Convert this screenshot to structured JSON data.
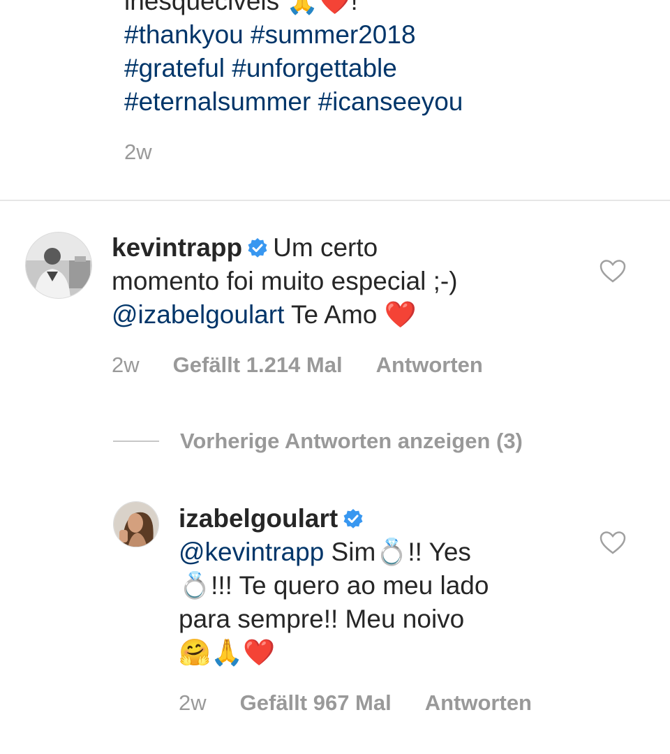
{
  "caption": {
    "line1": "inesqueciveis 🙏❤️!",
    "hashtags_line1": "#thankyou #summer2018",
    "hashtags_line2": "#grateful #unforgettable",
    "hashtags_line3": "#eternalsummer #icanseeyou",
    "time": "2w"
  },
  "comments": [
    {
      "username": "kevintrapp",
      "text_line1": "Um certo",
      "text_line2": "momento foi muito especial ;-)",
      "mention": "@izabelgoulart",
      "text_line3": " Te Amo ",
      "emoji": "❤️",
      "time": "2w",
      "likes": "Gefällt 1.214 Mal",
      "reply": "Antworten"
    }
  ],
  "replies_toggle": "Vorherige Antworten anzeigen (3)",
  "reply_comment": {
    "username": "izabelgoulart",
    "mention": "@kevintrapp",
    "text_a": " Sim",
    "ring1": "💍",
    "text_b": "!! Yes",
    "ring2": "💍",
    "text_c": "!!! Te quero ao meu lado",
    "text_d": "para sempre!! Meu noivo",
    "emojis": "🤗🙏❤️",
    "time": "2w",
    "likes": "Gefällt 967 Mal",
    "reply": "Antworten"
  },
  "icons": {
    "verified": "verified-badge-icon",
    "like": "heart-outline-icon"
  },
  "colors": {
    "hashtag": "#003569",
    "verified": "#3897f0",
    "meta": "#999999"
  }
}
